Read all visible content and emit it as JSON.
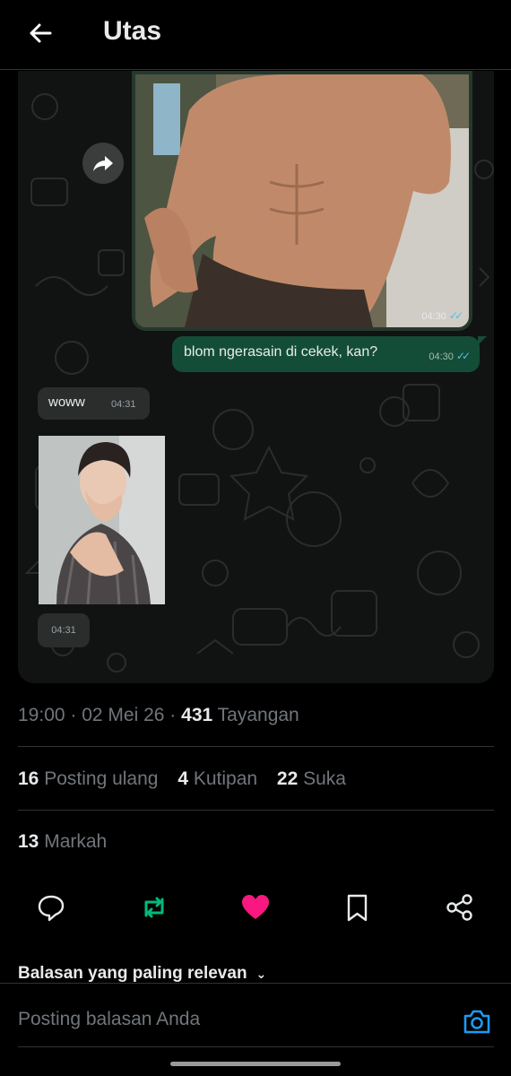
{
  "header": {
    "title": "Utas",
    "back_icon": "arrow-left-icon"
  },
  "chat": {
    "photo1_time": "04:30",
    "outgoing_text": "blom ngerasain di cekek, kan?",
    "outgoing_time": "04:30",
    "incoming_text": "woww",
    "incoming_time": "04:31",
    "photo2_time": "04:31",
    "read_ticks": "✓✓",
    "read_tick_color": "#53bdeb",
    "outgoing_bubble_color": "#144d37",
    "incoming_bubble_color": "#2a2d2c"
  },
  "post": {
    "time": "19:00",
    "date": "02 Mei 26",
    "views_count": "431",
    "views_label": "Tayangan",
    "reposts_count": "16",
    "reposts_label": "Posting ulang",
    "quotes_count": "4",
    "quotes_label": "Kutipan",
    "likes_count": "22",
    "likes_label": "Suka",
    "bookmarks_count": "13",
    "bookmarks_label": "Markah"
  },
  "actions": {
    "icons": [
      "reply-icon",
      "repost-icon",
      "like-icon",
      "bookmark-icon",
      "share-icon"
    ],
    "repost_color": "#00ba7c",
    "like_color": "#f91880"
  },
  "replies": {
    "sort_label": "Balasan yang paling relevan",
    "input_placeholder": "Posting balasan Anda",
    "accent_color": "#1d9bf0"
  }
}
